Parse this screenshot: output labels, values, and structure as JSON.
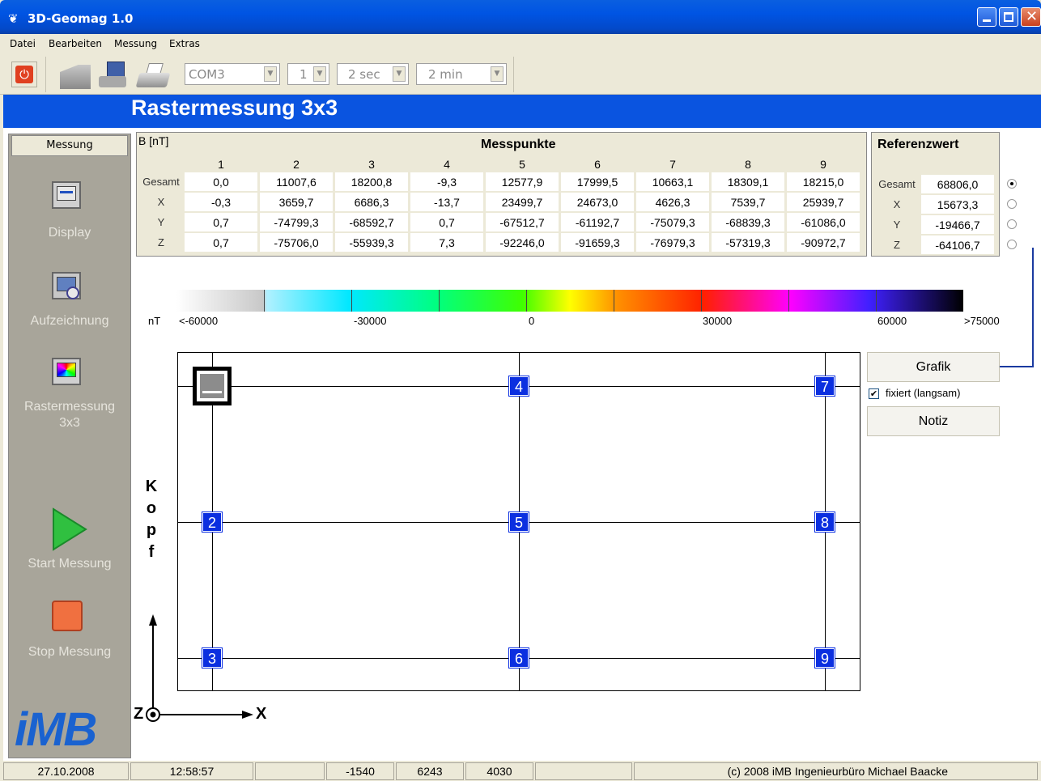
{
  "window": {
    "title": "3D-Geomag 1.0"
  },
  "menu": [
    "Datei",
    "Bearbeiten",
    "Messung",
    "Extras"
  ],
  "toolbar": {
    "port": "COM3",
    "channel": "1",
    "interval": "2 sec",
    "duration": "2 min"
  },
  "page_title": "Rastermessung 3x3",
  "sidebar": {
    "header": "Messung",
    "items": [
      {
        "label": "Display"
      },
      {
        "label": "Aufzeichnung"
      },
      {
        "label": "Rastermessung\n3x3"
      },
      {
        "label": "Start Messung"
      },
      {
        "label": "Stop Messung"
      }
    ],
    "logo": "iMB"
  },
  "table": {
    "unit": "B [nT]",
    "title": "Messpunkte",
    "columns": [
      "1",
      "2",
      "3",
      "4",
      "5",
      "6",
      "7",
      "8",
      "9"
    ],
    "rows": [
      {
        "label": "Gesamt",
        "values": [
          "0,0",
          "11007,6",
          "18200,8",
          "-9,3",
          "12577,9",
          "17999,5",
          "10663,1",
          "18309,1",
          "18215,0"
        ]
      },
      {
        "label": "X",
        "values": [
          "-0,3",
          "3659,7",
          "6686,3",
          "-13,7",
          "23499,7",
          "24673,0",
          "4626,3",
          "7539,7",
          "25939,7"
        ]
      },
      {
        "label": "Y",
        "values": [
          "0,7",
          "-74799,3",
          "-68592,7",
          "0,7",
          "-67512,7",
          "-61192,7",
          "-75079,3",
          "-68839,3",
          "-61086,0"
        ]
      },
      {
        "label": "Z",
        "values": [
          "0,7",
          "-75706,0",
          "-55939,3",
          "7,3",
          "-92246,0",
          "-91659,3",
          "-76979,3",
          "-57319,3",
          "-90972,7"
        ]
      }
    ]
  },
  "reference": {
    "title": "Referenzwert",
    "rows": [
      {
        "label": "Gesamt",
        "value": "68806,0",
        "selected": true
      },
      {
        "label": "X",
        "value": "15673,3",
        "selected": false
      },
      {
        "label": "Y",
        "value": "-19466,7",
        "selected": false
      },
      {
        "label": "Z",
        "value": "-64106,7",
        "selected": false
      }
    ]
  },
  "colorbar": {
    "unit": "nT",
    "labels": [
      "<-60000",
      "-30000",
      "0",
      "30000",
      "60000",
      ">75000"
    ]
  },
  "grid": {
    "points": [
      "2",
      "3",
      "4",
      "5",
      "6",
      "7",
      "8",
      "9"
    ],
    "side_label": [
      "K",
      "o",
      "p",
      "f"
    ],
    "axis_x": "X",
    "axis_z": "Z"
  },
  "buttons": {
    "grafik": "Grafik",
    "fixiert": "fixiert (langsam)",
    "fixiert_checked": true,
    "notiz": "Notiz"
  },
  "status": {
    "date": "27.10.2008",
    "time": "12:58:57",
    "v1": "-1540",
    "v2": "6243",
    "v3": "4030",
    "copyright": "(c) 2008  iMB  Ingenieurbüro Michael Baacke"
  }
}
